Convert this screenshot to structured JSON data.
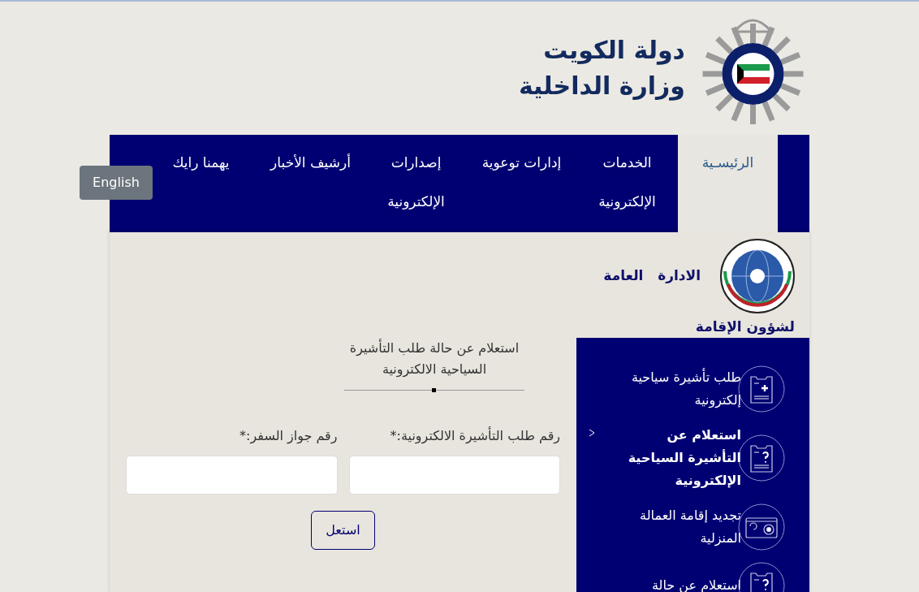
{
  "header": {
    "title_line1": "دولة الكويت",
    "title_line2": "وزارة الداخلية"
  },
  "language_button": "English",
  "nav": [
    {
      "label": "الرئيسـية",
      "selected": true
    },
    {
      "label": "الخدمات الإلكترونية",
      "selected": false
    },
    {
      "label": "إدارات توعوية",
      "selected": false
    },
    {
      "label": "إصدارات الإلكترونية",
      "selected": false
    },
    {
      "label": "أرشيف الأخبار",
      "selected": false
    },
    {
      "label": "يهمنا رايك",
      "selected": false
    }
  ],
  "department": {
    "line1": "الادارة   العامة",
    "line2": "لشؤون الإقامة"
  },
  "sidebar": [
    {
      "label": "طلب تأشيرة سياحية إلكترونية",
      "kind": "plus",
      "selected": false
    },
    {
      "label": "استعلام عن التأشيرة السياحية الإلكترونية",
      "kind": "question",
      "selected": true
    },
    {
      "label": "تجديد إقامة العمالة المنزلية",
      "kind": "renew",
      "selected": false
    },
    {
      "label": "استعلام عن حالة",
      "kind": "question",
      "selected": false
    }
  ],
  "form": {
    "title": "استعلام عن حالة طلب التأشيرة السياحية الالكترونية",
    "fields": [
      {
        "label": "رقم طلب التأشيرة الالكترونية:*"
      },
      {
        "label": "رقم جواز السفر:*"
      }
    ],
    "submit": "استعل"
  }
}
